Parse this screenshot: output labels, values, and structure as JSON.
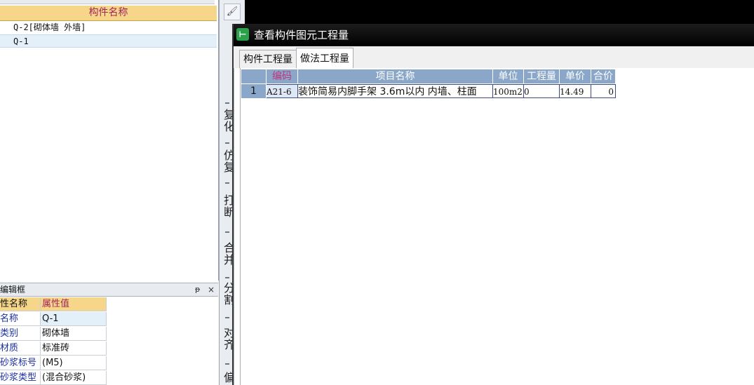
{
  "component_list": {
    "header": "构件名称",
    "rows": [
      "Q-2[砌体墙 外墙]",
      "Q-1"
    ],
    "selected_index": 1
  },
  "property_editor": {
    "title": "编辑框",
    "pin_glyph": "ᵽ",
    "close_glyph": "×",
    "col_name": "性名称",
    "col_value": "属性值",
    "rows": [
      {
        "name": "名称",
        "value": "Q-1"
      },
      {
        "name": "类别",
        "value": "砌体墙"
      },
      {
        "name": "材质",
        "value": "标准砖"
      },
      {
        "name": "砂浆标号",
        "value": "(M5)"
      },
      {
        "name": "砂浆类型",
        "value": "(混合砂浆)"
      }
    ]
  },
  "mid_toolbar": {
    "brush_icon": "🖌",
    "vertical_labels": [
      "复\n化",
      "仿\n复",
      "打\n断",
      "合\n并",
      "分\n割",
      "对\n齐",
      "偏"
    ]
  },
  "dialog": {
    "title": "查看构件图元工程量",
    "icon_glyph": "⊢",
    "tabs": [
      "构件工程量",
      "做法工程量"
    ],
    "active_tab": 1,
    "grid": {
      "headers": [
        "",
        "编码",
        "项目名称",
        "单位",
        "工程量",
        "单价",
        "合价"
      ],
      "rows": [
        [
          "1",
          "A21-6",
          "装饰简易内脚手架 3.6m以内 内墙、柱面",
          "100m2",
          "0",
          "14.49",
          "0"
        ]
      ]
    }
  },
  "colors": {
    "header_gold": "#f6d789",
    "grid_header_blue": "#8aa7c9",
    "selection_blue": "#e3eff9",
    "dialog_titlebar": "#000000"
  }
}
